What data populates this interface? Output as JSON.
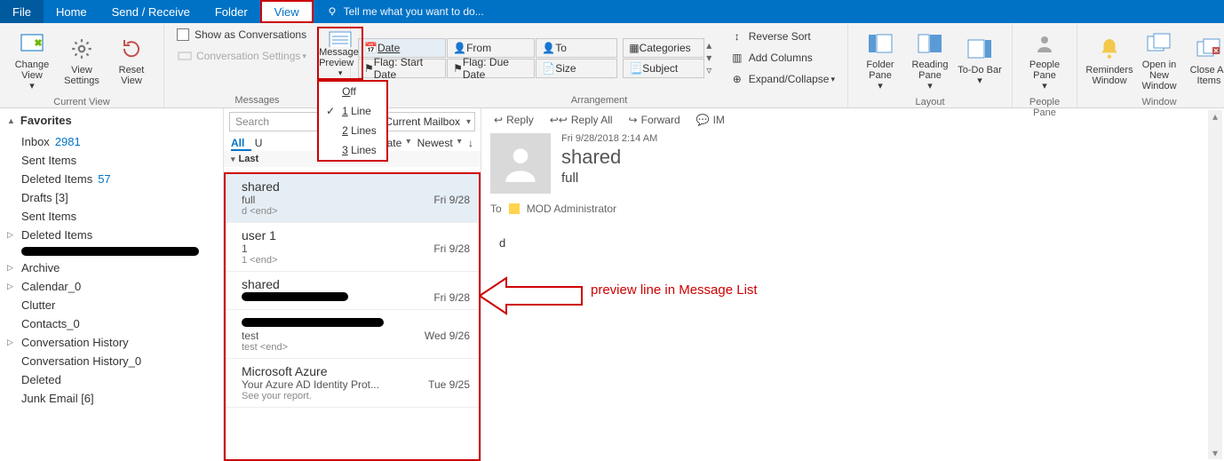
{
  "ribbon_tabs": {
    "file": "File",
    "home": "Home",
    "sendreceive": "Send / Receive",
    "folder": "Folder",
    "view": "View",
    "tellme": "Tell me what you want to do..."
  },
  "current_view": {
    "change_view": "Change View",
    "view_settings": "View Settings",
    "reset_view": "Reset View",
    "label": "Current View"
  },
  "messages_group": {
    "show_as_conv": "Show as Conversations",
    "conv_settings": "Conversation Settings",
    "message_preview": "Message Preview",
    "label": "Messages",
    "menu": {
      "off": "Off",
      "l1": "1 Line",
      "l2": "2 Lines",
      "l3": "3 Lines"
    }
  },
  "arrangement": {
    "date": "Date",
    "from": "From",
    "to": "To",
    "categories": "Categories",
    "flag_start": "Flag: Start Date",
    "flag_due": "Flag: Due Date",
    "size": "Size",
    "subject": "Subject",
    "rev_sort": "Reverse Sort",
    "add_cols": "Add Columns",
    "expcol": "Expand/Collapse",
    "label": "Arrangement"
  },
  "layout": {
    "folder_pane": "Folder Pane",
    "reading_pane": "Reading Pane",
    "todo_bar": "To-Do Bar",
    "label": "Layout"
  },
  "people": {
    "people_pane": "People Pane",
    "label": "People Pane"
  },
  "window": {
    "reminders": "Reminders Window",
    "open_new": "Open in New Window",
    "close_all": "Close All Items",
    "label": "Window"
  },
  "nav": {
    "favorites": "Favorites",
    "items": [
      {
        "label": "Inbox",
        "count": "2981"
      },
      {
        "label": "Sent Items"
      },
      {
        "label": "Deleted Items",
        "count": "57"
      },
      {
        "label": "Drafts [3]"
      },
      {
        "label": "Sent Items"
      },
      {
        "label": "Deleted Items",
        "expand": true
      },
      {
        "label": "",
        "redact": 200
      },
      {
        "label": "Archive",
        "expand": true
      },
      {
        "label": "Calendar_0",
        "expand": true
      },
      {
        "label": "Clutter"
      },
      {
        "label": "Contacts_0"
      },
      {
        "label": "Conversation History",
        "expand": true
      },
      {
        "label": "Conversation History_0"
      },
      {
        "label": "Deleted"
      },
      {
        "label": "Junk Email [6]"
      }
    ]
  },
  "list": {
    "search": "Search",
    "mailbox": "Current Mailbox",
    "all": "All",
    "unread": "U",
    "bydate": "By Date",
    "newest": "Newest",
    "group_header": "Last",
    "messages": [
      {
        "from": "shared",
        "subject": "full",
        "date": "Fri 9/28",
        "preview": "d <end>",
        "selected": true
      },
      {
        "from": "user 1",
        "subject": "1",
        "date": "Fri 9/28",
        "preview": "1 <end>"
      },
      {
        "from": "shared",
        "subject_redact": 120,
        "date": "Fri 9/28",
        "preview": ""
      },
      {
        "from_redact": 160,
        "subject": "test",
        "date": "Wed 9/26",
        "preview": "test <end>"
      },
      {
        "from": "Microsoft Azure",
        "subject": "Your Azure AD Identity Prot...",
        "date": "Tue 9/25",
        "preview": "See your report."
      }
    ]
  },
  "read": {
    "reply": "Reply",
    "reply_all": "Reply All",
    "forward": "Forward",
    "im": "IM",
    "date": "Fri 9/28/2018 2:14 AM",
    "sender": "shared",
    "subject": "full",
    "to_label": "To",
    "to_recipient": "MOD Administrator",
    "body": "d"
  },
  "annotation": "preview line in Message List"
}
